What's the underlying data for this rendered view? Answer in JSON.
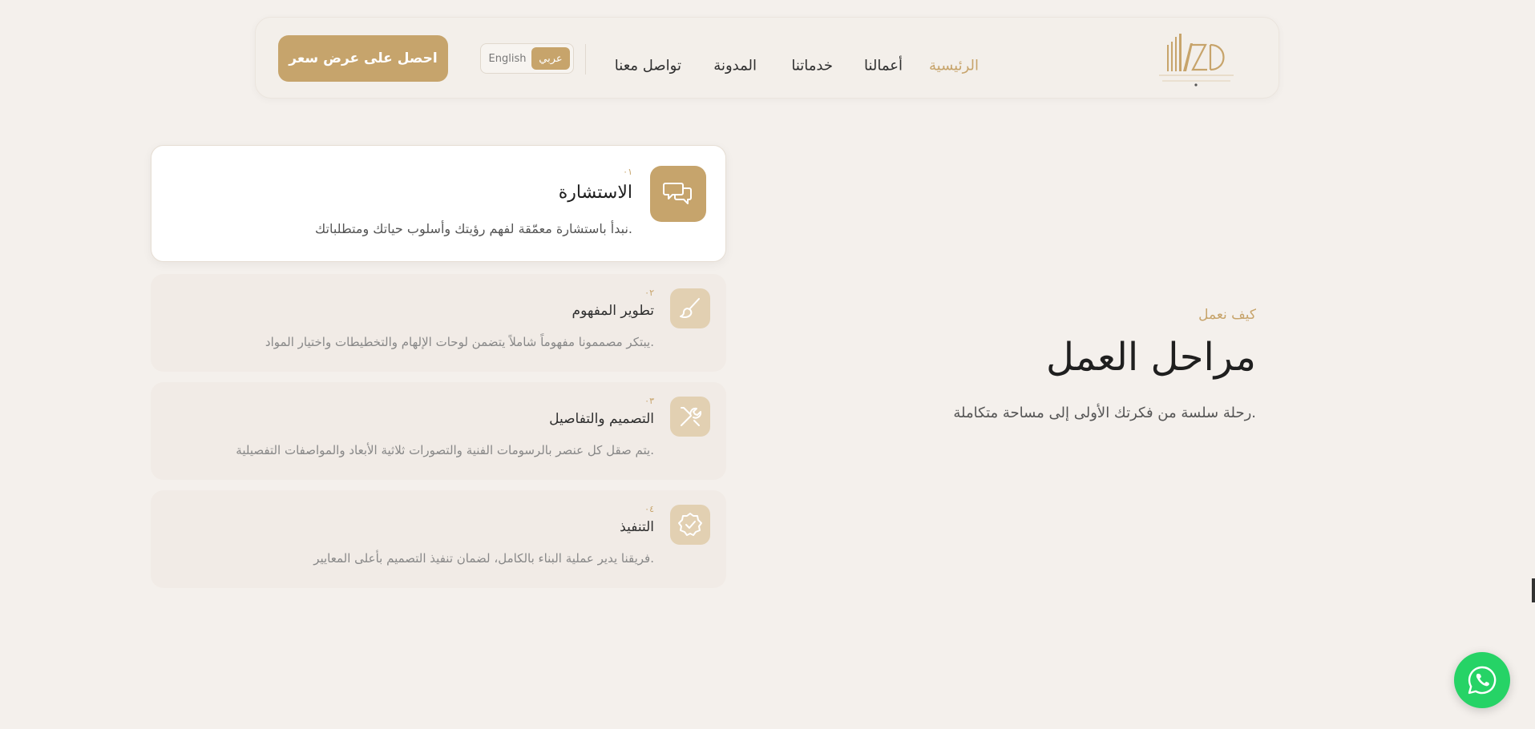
{
  "header": {
    "logo": {
      "text": "AZD",
      "subtitle": "ART ZONE DESIGN",
      "tagline": "INTERIOR DESIGN & BUILDING"
    },
    "nav": [
      {
        "label": "الرئيسية",
        "active": true
      },
      {
        "label": "أعمالنا",
        "active": false
      },
      {
        "label": "خدماتنا",
        "active": false
      },
      {
        "label": "المدونة",
        "active": false
      },
      {
        "label": "تواصل معنا",
        "active": false
      }
    ],
    "lang": {
      "ar": "عربي",
      "en": "English",
      "selected": "ar"
    },
    "cta_label": "احصل على عرض سعر"
  },
  "intro": {
    "eyebrow": "كيف نعمل",
    "title": "مراحل العمل",
    "subtitle": "رحلة سلسة من فكرتك الأولى إلى مساحة متكاملة."
  },
  "steps": [
    {
      "number": "٠١",
      "title": "الاستشارة",
      "description": "نبدأ باستشارة معمّقة لفهم رؤيتك وأسلوب حياتك ومتطلباتك.",
      "icon": "chat-bubbles-icon",
      "active": true
    },
    {
      "number": "٠٢",
      "title": "تطوير المفهوم",
      "description": "يبتكر مصممونا مفهوماً شاملاً يتضمن لوحات الإلهام والتخطيطات واختيار المواد.",
      "icon": "brush-icon",
      "active": false
    },
    {
      "number": "٠٣",
      "title": "التصميم والتفاصيل",
      "description": "يتم صقل كل عنصر بالرسومات الفنية والتصورات ثلاثية الأبعاد والمواصفات التفصيلية.",
      "icon": "tools-icon",
      "active": false
    },
    {
      "number": "٠٤",
      "title": "التنفيذ",
      "description": "فريقنا يدير عملية البناء بالكامل، لضمان تنفيذ التصميم بأعلى المعايير.",
      "icon": "badge-check-icon",
      "active": false
    }
  ],
  "colors": {
    "accent": "#c6a46c",
    "background": "#f4f0ec",
    "card_inactive": "#f1ebe6",
    "whatsapp": "#26d366"
  },
  "whatsapp": {
    "icon": "whatsapp-icon"
  }
}
